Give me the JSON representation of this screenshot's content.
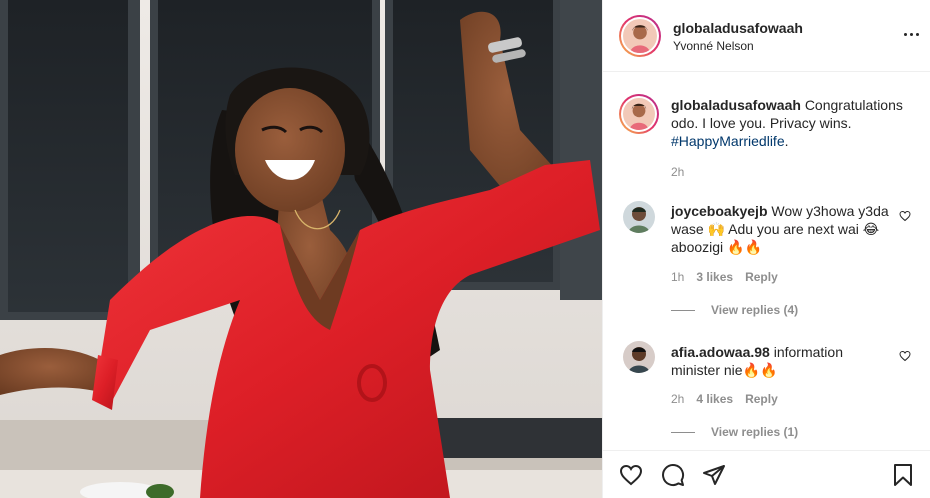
{
  "post": {
    "author": {
      "username": "globaladusafowaah",
      "location": "Yvonné Nelson",
      "avatar_icon": "profile-avatar"
    },
    "caption": {
      "username": "globaladusafowaah",
      "text": "Congratulations odo. I love you. Privacy wins.",
      "hashtag": "#HappyMarriedlife",
      "trailing": ".",
      "time": "2h"
    },
    "comments": [
      {
        "username": "joyceboakyejb",
        "text": "Wow y3howa y3da wase 🙌 Adu you are next wai 😂 aboozigi 🔥🔥",
        "time": "1h",
        "likes": "3 likes",
        "reply_label": "Reply",
        "view_replies": "View replies (4)"
      },
      {
        "username": "afia.adowaa.98",
        "text": "information minister nie🔥🔥",
        "time": "2h",
        "likes": "4 likes",
        "reply_label": "Reply",
        "view_replies": "View replies (1)"
      }
    ],
    "actions": {
      "like_icon": "heart-icon",
      "comment_icon": "comment-icon",
      "share_icon": "share-icon",
      "save_icon": "bookmark-icon"
    },
    "colors": {
      "text": "#262626",
      "muted": "#8e8e8e",
      "hashtag": "#00376b",
      "dress_red": "#e3242b",
      "border": "#efefef"
    }
  }
}
